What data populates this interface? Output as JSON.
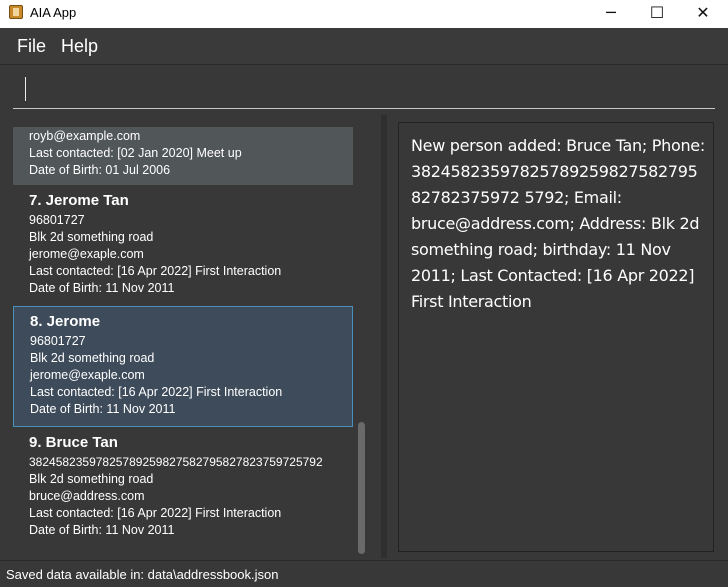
{
  "window": {
    "title": "AIA App",
    "app_icon": "address-book-icon",
    "controls": {
      "minimize": "─",
      "maximize": "☐",
      "close": "✕"
    }
  },
  "menu": {
    "file": "File",
    "help": "Help"
  },
  "command": {
    "value": "",
    "placeholder": ""
  },
  "persons": [
    {
      "partial": true,
      "name": "",
      "phone": "",
      "address": "",
      "email": "royb@example.com",
      "last_contacted": "Last contacted: [02 Jan 2020] Meet up",
      "dob": "Date of Birth: 01 Jul 2006"
    },
    {
      "name": "7.  Jerome Tan",
      "phone": "96801727",
      "address": "Blk 2d something road",
      "email": "jerome@exaple.com",
      "last_contacted": "Last contacted: [16 Apr 2022] First Interaction",
      "dob": "Date of Birth: 11 Nov 2011"
    },
    {
      "name": "8.  Jerome",
      "phone": "96801727",
      "address": "Blk 2d something road",
      "email": "jerome@exaple.com",
      "last_contacted": "Last contacted: [16 Apr 2022] First Interaction",
      "dob": "Date of Birth: 11 Nov 2011"
    },
    {
      "name": "9.  Bruce Tan",
      "phone": "382458235978257892598275827958278237597257​92",
      "address": "Blk 2d something road",
      "email": "bruce@address.com",
      "last_contacted": "Last contacted: [16 Apr 2022] First Interaction",
      "dob": "Date of Birth: 11 Nov 2011"
    }
  ],
  "result": {
    "text": "New person added: Bruce Tan; Phone: 3824582359782578925982758279582782375972 5792; Email: bruce@address.com; Address: Blk 2d something road; birthday: 11 Nov 2011; Last Contacted: [16 Apr 2022] First Interaction"
  },
  "status": {
    "text": "Saved data available in: data\\addressbook.json"
  },
  "colors": {
    "background": "#383838",
    "card_a": "#383838",
    "card_b": "#515658",
    "selected": "#3e4b5a",
    "selected_border": "#4a90b8"
  }
}
